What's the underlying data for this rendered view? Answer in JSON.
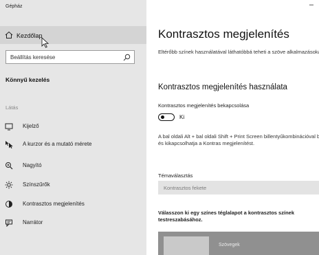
{
  "window": {
    "title": "Gépház",
    "minimize_glyph": "–"
  },
  "sidebar": {
    "home_label": "Kezdőlap",
    "search_placeholder": "Beállítás keresése",
    "section_title": "Könnyű kezelés",
    "group_title": "Látás",
    "items": [
      {
        "label": "Kijelző",
        "icon": "monitor-icon"
      },
      {
        "label": "A kurzor és a mutató mérete",
        "icon": "cursor-size-icon"
      },
      {
        "label": "Nagyító",
        "icon": "magnifier-icon"
      },
      {
        "label": "Színszűrők",
        "icon": "color-filter-icon"
      },
      {
        "label": "Kontrasztos megjelenítés",
        "icon": "high-contrast-icon"
      },
      {
        "label": "Narrátor",
        "icon": "narrator-icon"
      }
    ]
  },
  "main": {
    "title": "Kontrasztos megjelenítés",
    "description": "Eltérőbb színek használatával láthatóbbá teheti a szöve alkalmazásokat.",
    "section_title": "Kontrasztos megjelenítés használata",
    "toggle_label": "Kontrasztos megjelenítés bekapcsolása",
    "toggle_state": "Ki",
    "toggle_on": false,
    "shortcut_info": "A bal oldali Alt + bal oldali Shift + Print Screen billentyűkombinációval be- és kikapcsolhatja a Kontras megjelenítést.",
    "theme_label": "Témaválasztás",
    "theme_value": "Kontrasztos fekete",
    "pick_text": "Válasszon ki egy színes téglalapot a kontrasztos színek testreszabásához.",
    "preview_text": "Szövegek"
  },
  "colors": {
    "sidebar_bg": "#e6e6e6",
    "selected_bg": "#d4d4d4",
    "main_bg": "#ffffff",
    "dropdown_bg": "#e3e3e3",
    "preview_bg": "#909090"
  }
}
